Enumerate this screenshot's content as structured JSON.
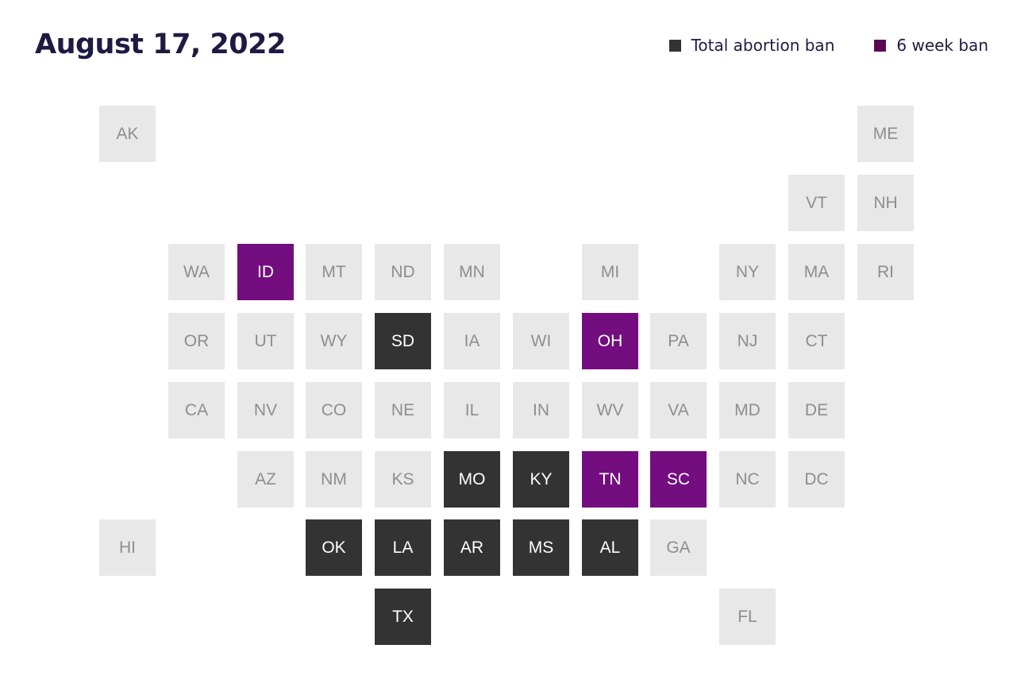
{
  "title": "August 17, 2022",
  "legend": [
    {
      "label": "Total abortion ban",
      "key": "total",
      "color": "#333333"
    },
    {
      "label": "6 week ban",
      "key": "six",
      "color": "#5a0a55"
    }
  ],
  "colors": {
    "none": "#e8e8e8",
    "total": "#333333",
    "six": "#730d80",
    "text_none": "#8e8e8e",
    "text_ban": "#ffffff"
  },
  "states": [
    {
      "abbr": "AK",
      "row": 0,
      "col": 0,
      "status": "none"
    },
    {
      "abbr": "ME",
      "row": 0,
      "col": 11,
      "status": "none"
    },
    {
      "abbr": "VT",
      "row": 1,
      "col": 10,
      "status": "none"
    },
    {
      "abbr": "NH",
      "row": 1,
      "col": 11,
      "status": "none"
    },
    {
      "abbr": "WA",
      "row": 2,
      "col": 1,
      "status": "none"
    },
    {
      "abbr": "ID",
      "row": 2,
      "col": 2,
      "status": "six"
    },
    {
      "abbr": "MT",
      "row": 2,
      "col": 3,
      "status": "none"
    },
    {
      "abbr": "ND",
      "row": 2,
      "col": 4,
      "status": "none"
    },
    {
      "abbr": "MN",
      "row": 2,
      "col": 5,
      "status": "none"
    },
    {
      "abbr": "MI",
      "row": 2,
      "col": 7,
      "status": "none"
    },
    {
      "abbr": "NY",
      "row": 2,
      "col": 9,
      "status": "none"
    },
    {
      "abbr": "MA",
      "row": 2,
      "col": 10,
      "status": "none"
    },
    {
      "abbr": "RI",
      "row": 2,
      "col": 11,
      "status": "none"
    },
    {
      "abbr": "OR",
      "row": 3,
      "col": 1,
      "status": "none"
    },
    {
      "abbr": "UT",
      "row": 3,
      "col": 2,
      "status": "none"
    },
    {
      "abbr": "WY",
      "row": 3,
      "col": 3,
      "status": "none"
    },
    {
      "abbr": "SD",
      "row": 3,
      "col": 4,
      "status": "total"
    },
    {
      "abbr": "IA",
      "row": 3,
      "col": 5,
      "status": "none"
    },
    {
      "abbr": "WI",
      "row": 3,
      "col": 6,
      "status": "none"
    },
    {
      "abbr": "OH",
      "row": 3,
      "col": 7,
      "status": "six"
    },
    {
      "abbr": "PA",
      "row": 3,
      "col": 8,
      "status": "none"
    },
    {
      "abbr": "NJ",
      "row": 3,
      "col": 9,
      "status": "none"
    },
    {
      "abbr": "CT",
      "row": 3,
      "col": 10,
      "status": "none"
    },
    {
      "abbr": "CA",
      "row": 4,
      "col": 1,
      "status": "none"
    },
    {
      "abbr": "NV",
      "row": 4,
      "col": 2,
      "status": "none"
    },
    {
      "abbr": "CO",
      "row": 4,
      "col": 3,
      "status": "none"
    },
    {
      "abbr": "NE",
      "row": 4,
      "col": 4,
      "status": "none"
    },
    {
      "abbr": "IL",
      "row": 4,
      "col": 5,
      "status": "none"
    },
    {
      "abbr": "IN",
      "row": 4,
      "col": 6,
      "status": "none"
    },
    {
      "abbr": "WV",
      "row": 4,
      "col": 7,
      "status": "none"
    },
    {
      "abbr": "VA",
      "row": 4,
      "col": 8,
      "status": "none"
    },
    {
      "abbr": "MD",
      "row": 4,
      "col": 9,
      "status": "none"
    },
    {
      "abbr": "DE",
      "row": 4,
      "col": 10,
      "status": "none"
    },
    {
      "abbr": "AZ",
      "row": 5,
      "col": 2,
      "status": "none"
    },
    {
      "abbr": "NM",
      "row": 5,
      "col": 3,
      "status": "none"
    },
    {
      "abbr": "KS",
      "row": 5,
      "col": 4,
      "status": "none"
    },
    {
      "abbr": "MO",
      "row": 5,
      "col": 5,
      "status": "total"
    },
    {
      "abbr": "KY",
      "row": 5,
      "col": 6,
      "status": "total"
    },
    {
      "abbr": "TN",
      "row": 5,
      "col": 7,
      "status": "six"
    },
    {
      "abbr": "SC",
      "row": 5,
      "col": 8,
      "status": "six"
    },
    {
      "abbr": "NC",
      "row": 5,
      "col": 9,
      "status": "none"
    },
    {
      "abbr": "DC",
      "row": 5,
      "col": 10,
      "status": "none"
    },
    {
      "abbr": "HI",
      "row": 6,
      "col": 0,
      "status": "none"
    },
    {
      "abbr": "OK",
      "row": 6,
      "col": 3,
      "status": "total"
    },
    {
      "abbr": "LA",
      "row": 6,
      "col": 4,
      "status": "total"
    },
    {
      "abbr": "AR",
      "row": 6,
      "col": 5,
      "status": "total"
    },
    {
      "abbr": "MS",
      "row": 6,
      "col": 6,
      "status": "total"
    },
    {
      "abbr": "AL",
      "row": 6,
      "col": 7,
      "status": "total"
    },
    {
      "abbr": "GA",
      "row": 6,
      "col": 8,
      "status": "none"
    },
    {
      "abbr": "TX",
      "row": 7,
      "col": 4,
      "status": "total"
    },
    {
      "abbr": "FL",
      "row": 7,
      "col": 9,
      "status": "none"
    }
  ]
}
